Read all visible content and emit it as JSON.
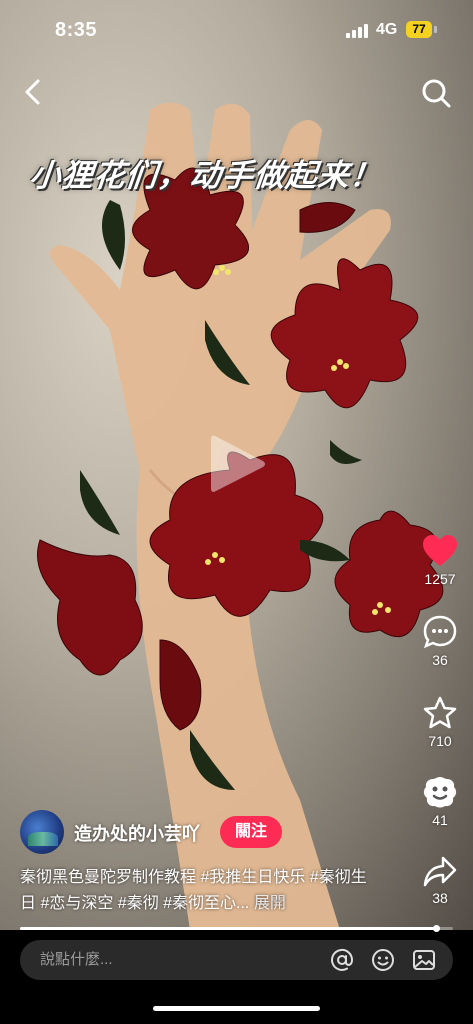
{
  "status_bar": {
    "time": "8:35",
    "network": "4G",
    "battery": "77"
  },
  "video": {
    "overlay_title": "小狸花们，动手做起来！",
    "state": "paused"
  },
  "actions": {
    "likes": "1257",
    "comments": "36",
    "favorites": "710",
    "shares_other": "41",
    "shares": "38"
  },
  "author": {
    "name": "造办处的小芸吖",
    "follow_label": "關注"
  },
  "description": {
    "text": "秦彻黑色曼陀罗制作教程 #我推生日快乐 #秦彻生日 #恋与深空 #秦彻 #秦彻至心...",
    "more_label": "展開"
  },
  "progress": {
    "played_fraction": 0.96
  },
  "comment_bar": {
    "placeholder": "說點什麼..."
  },
  "colors": {
    "accent": "#fe2c55",
    "like": "#fe2c55",
    "battery": "#f4d21f"
  }
}
